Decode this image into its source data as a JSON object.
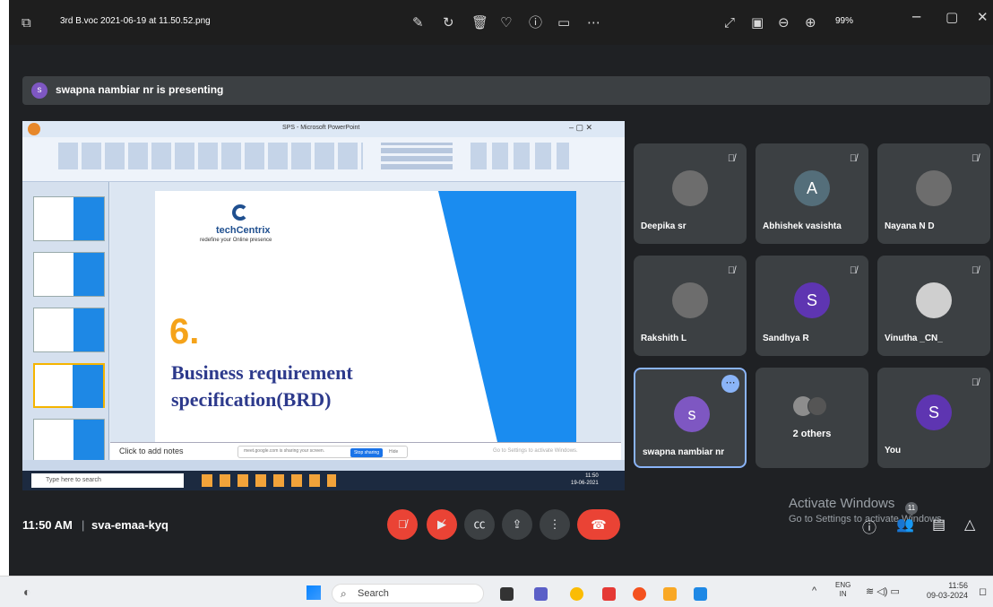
{
  "viewer": {
    "filename": "3rd B.voc 2021-06-19 at 11.50.52.png",
    "zoom": "99%",
    "icons": [
      "edit-icon",
      "rotate-icon",
      "delete-icon",
      "favorite-icon",
      "info-icon",
      "slideshow-icon",
      "more-icon",
      "expand-icon",
      "fit-icon",
      "zoom-out-icon",
      "zoom-in-icon",
      "minimize-icon",
      "maximize-icon",
      "close-icon"
    ]
  },
  "meet": {
    "presenting": {
      "avatar_initial": "s",
      "text": "swapna nambiar nr is presenting"
    },
    "shared_screen": {
      "window_title": "SPS - Microsoft PowerPoint",
      "slide": {
        "logo_name": "techCentrix",
        "logo_tagline": "redefine your Online presence",
        "number": "6.",
        "heading_line1": "Business requirement",
        "heading_line2": "specification(BRD)"
      },
      "notes_placeholder": "Click to add notes",
      "share_notice": "meet.google.com is sharing your screen.",
      "stop_sharing": "Stop sharing",
      "hide": "Hide",
      "activate_hint": "Go to Settings to activate Windows.",
      "search_placeholder": "Type here to search",
      "clock_time": "11:50",
      "clock_date": "19-06-2021"
    },
    "participants": [
      {
        "name": "Deepika sr",
        "avatar": "photo",
        "muted": true
      },
      {
        "name": "Abhishek vasishta",
        "avatar": "A",
        "color": "#546e7a",
        "muted": true
      },
      {
        "name": "Nayana N D",
        "avatar": "photo",
        "muted": true
      },
      {
        "name": "Rakshith L",
        "avatar": "photo",
        "muted": true
      },
      {
        "name": "Sandhya R",
        "avatar": "S",
        "color": "#5e35b1",
        "muted": true
      },
      {
        "name": "Vinutha _CN_",
        "avatar": "photo",
        "muted": true
      },
      {
        "name": "swapna nambiar nr",
        "avatar": "s",
        "color": "#7e57c2",
        "muted": false
      },
      {
        "name": "2 others",
        "avatar": "group",
        "muted": false
      },
      {
        "name": "You",
        "avatar": "S",
        "color": "#5e35b1",
        "muted": true
      }
    ],
    "time": "11:50 AM",
    "separator": "|",
    "meeting_code": "sva-emaa-kyq",
    "controls": [
      "mic-off",
      "camera-off",
      "captions",
      "present",
      "more",
      "leave"
    ],
    "activate_title": "Activate Windows",
    "activate_sub": "Go to Settings to activate Windows.",
    "people_badge": "11"
  },
  "taskbar": {
    "search": "Search",
    "lang_line1": "ENG",
    "lang_line2": "IN",
    "time": "11:56",
    "date": "09-03-2024"
  }
}
